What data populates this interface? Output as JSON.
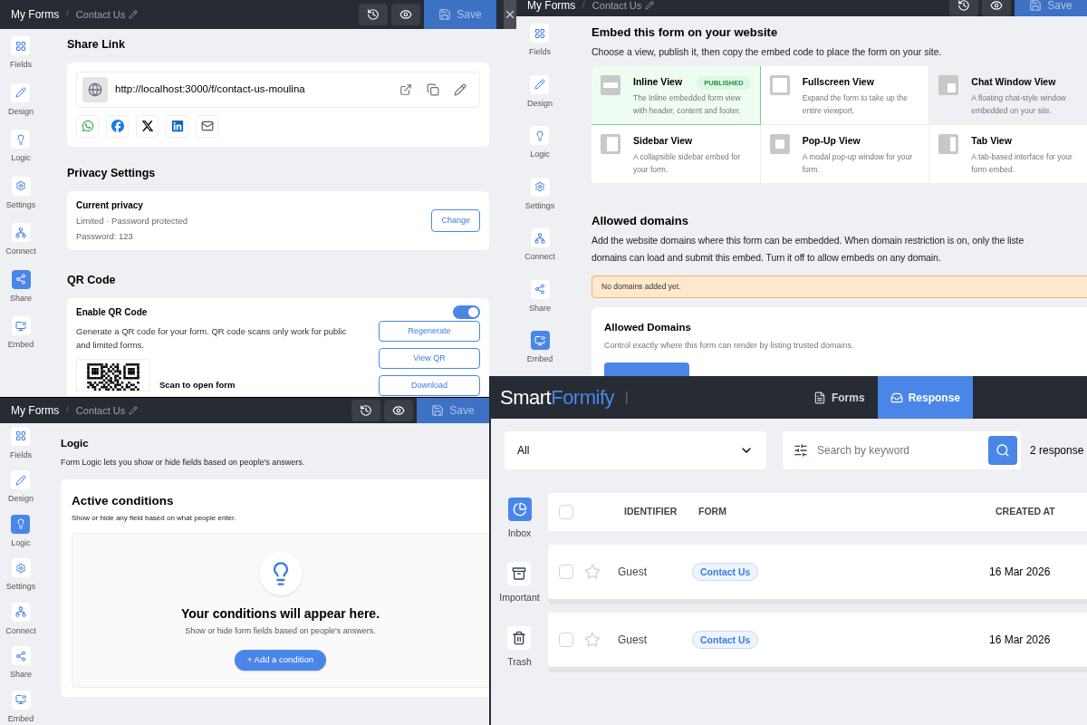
{
  "share_window": {
    "breadcrumb": {
      "root": "My Forms",
      "separator": "/",
      "current": "Contact Us"
    },
    "save": "Save",
    "sidebar": [
      {
        "kind": "fields",
        "label": "Fields",
        "selected": false
      },
      {
        "kind": "design",
        "label": "Design",
        "selected": false
      },
      {
        "kind": "logic",
        "label": "Logic",
        "selected": false
      },
      {
        "kind": "settings",
        "label": "Settings",
        "selected": false
      },
      {
        "kind": "connect",
        "label": "Connect",
        "selected": false
      },
      {
        "kind": "share",
        "label": "Share",
        "selected": true
      },
      {
        "kind": "embed",
        "label": "Embed",
        "selected": false
      }
    ],
    "share_link": {
      "title": "Share Link",
      "url": "http://localhost:3000/f/contact-us-moulina"
    },
    "privacy": {
      "title": "Privacy Settings",
      "card_title": "Current privacy",
      "lines": [
        "Limited · Password protected",
        "Password: 123"
      ],
      "button": "Change"
    },
    "qr": {
      "title": "QR Code",
      "toggle_label": "Enable QR Code",
      "on": true,
      "description": "Generate a QR code for your form. QR code scans only work for public and limited forms.",
      "buttons": [
        "Regenerate",
        "View QR",
        "Download"
      ],
      "caption": "Scan to open form"
    }
  },
  "embed_window": {
    "breadcrumb": {
      "root": "My Forms",
      "separator": "/",
      "current": "Contact Us"
    },
    "save": "Save",
    "sidebar": [
      {
        "kind": "fields",
        "label": "Fields",
        "selected": false
      },
      {
        "kind": "design",
        "label": "Design",
        "selected": false
      },
      {
        "kind": "logic",
        "label": "Logic",
        "selected": false
      },
      {
        "kind": "settings",
        "label": "Settings",
        "selected": false
      },
      {
        "kind": "connect",
        "label": "Connect",
        "selected": false
      },
      {
        "kind": "share",
        "label": "Share",
        "selected": false
      },
      {
        "kind": "embed",
        "label": "Embed",
        "selected": true
      }
    ],
    "title": "Embed this form on your website",
    "subtitle": "Choose a view, publish it, then copy the embed code to place the form on your site.",
    "views": [
      {
        "kind": "inline",
        "name": "Inline View",
        "badge": "PUBLISHED",
        "description": "The Inline embedded form view with header, content and footer.",
        "selected": true,
        "hovered": false
      },
      {
        "kind": "fullscreen",
        "name": "Fullscreen View",
        "description": "Expand the form to take up the entire viewport.",
        "selected": false,
        "hovered": false
      },
      {
        "kind": "chat",
        "name": "Chat Window View",
        "description": "A floating chat-style window embedded on your site.",
        "selected": false,
        "hovered": true
      },
      {
        "kind": "sidebar",
        "name": "Sidebar View",
        "description": "A collapsible sidebar embed for your form.",
        "selected": false,
        "hovered": false
      },
      {
        "kind": "popup",
        "name": "Pop-Up View",
        "description": "A modal pop-up window for your form.",
        "selected": false,
        "hovered": false
      },
      {
        "kind": "tab",
        "name": "Tab View",
        "description": "A tab-based interface for your form embed.",
        "selected": false,
        "hovered": false
      }
    ],
    "domains": {
      "title": "Allowed domains",
      "lines": [
        "Add the website domains where this form can be embedded. When domain restriction is on, only the liste",
        "domains can load and submit this embed. Turn it off to allow embeds on any domain."
      ],
      "notice": "No domains added yet.",
      "card_title": "Allowed Domains",
      "card_text": "Control exactly where this form can render by listing trusted domains."
    }
  },
  "logic_window": {
    "breadcrumb": {
      "root": "My Forms",
      "separator": "/",
      "current": "Contact Us"
    },
    "save": "Save",
    "sidebar": [
      {
        "kind": "fields",
        "label": "Fields",
        "selected": false
      },
      {
        "kind": "design",
        "label": "Design",
        "selected": false
      },
      {
        "kind": "logic",
        "label": "Logic",
        "selected": true
      },
      {
        "kind": "settings",
        "label": "Settings",
        "selected": false
      },
      {
        "kind": "connect",
        "label": "Connect",
        "selected": false
      },
      {
        "kind": "share",
        "label": "Share",
        "selected": false
      },
      {
        "kind": "embed",
        "label": "Embed",
        "selected": false
      }
    ],
    "title": "Logic",
    "subtitle": "Form Logic lets you show or hide fields based on people's answers.",
    "card_title": "Active conditions",
    "card_text": "Show or hide any field based on what people enter.",
    "empty_title": "Your conditions will appear here.",
    "empty_text": "Show or hide form fields based on people's answers.",
    "button": "+ Add a condition"
  },
  "responses_window": {
    "logo": {
      "first": "Smart",
      "second": "Formify"
    },
    "divider": "|",
    "all_checked": false,
    "tabs": [
      {
        "label": "Forms",
        "selected": false
      },
      {
        "label": "Response",
        "selected": true
      }
    ],
    "filter": "All",
    "search_placeholder": "Search by keyword",
    "count": "2 response",
    "folders": [
      {
        "kind": "inbox",
        "label": "Inbox",
        "selected": true
      },
      {
        "kind": "important",
        "label": "Important",
        "selected": false
      },
      {
        "kind": "trash",
        "label": "Trash",
        "selected": false
      }
    ],
    "columns": [
      "IDENTIFIER",
      "FORM",
      "CREATED AT"
    ],
    "rows": [
      {
        "identifier": "Guest",
        "form": "Contact Us",
        "created_at": "16 Mar 2026",
        "checked": false,
        "starred": false
      },
      {
        "identifier": "Guest",
        "form": "Contact Us",
        "created_at": "16 Mar 2026",
        "checked": false,
        "starred": false
      }
    ]
  }
}
